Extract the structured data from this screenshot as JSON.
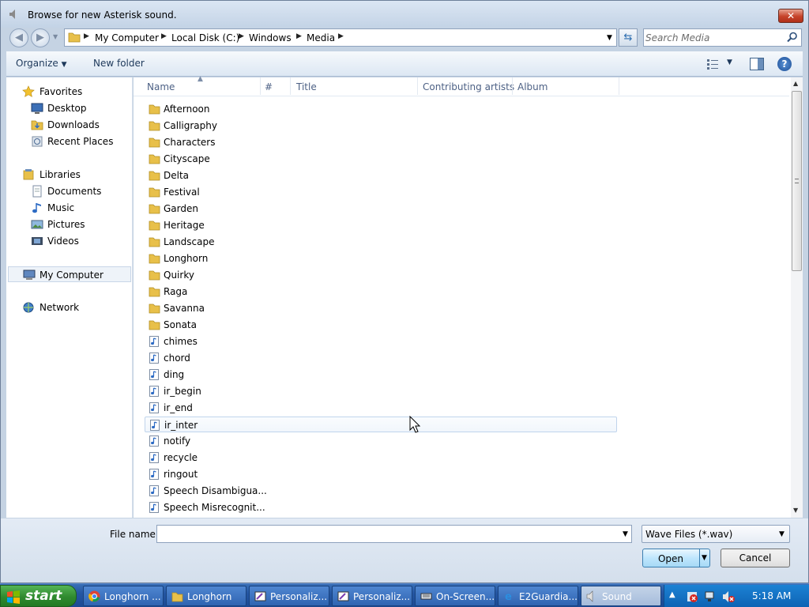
{
  "window": {
    "title": "Browse for new Asterisk sound.",
    "close_glyph": "✕"
  },
  "address": {
    "crumbs": [
      "My Computer",
      "Local Disk (C:)",
      "Windows",
      "Media"
    ],
    "search_placeholder": "Search Media"
  },
  "toolbar": {
    "organize_label": "Organize",
    "new_folder_label": "New folder"
  },
  "navpane": {
    "favorites": {
      "label": "Favorites",
      "items": [
        "Desktop",
        "Downloads",
        "Recent Places"
      ]
    },
    "libraries": {
      "label": "Libraries",
      "items": [
        "Documents",
        "Music",
        "Pictures",
        "Videos"
      ]
    },
    "computer": "My Computer",
    "network": "Network"
  },
  "columns": [
    "Name",
    "#",
    "Title",
    "Contributing artists",
    "Album"
  ],
  "files": [
    {
      "name": "Afternoon",
      "kind": "folder"
    },
    {
      "name": "Calligraphy",
      "kind": "folder"
    },
    {
      "name": "Characters",
      "kind": "folder"
    },
    {
      "name": "Cityscape",
      "kind": "folder"
    },
    {
      "name": "Delta",
      "kind": "folder"
    },
    {
      "name": "Festival",
      "kind": "folder"
    },
    {
      "name": "Garden",
      "kind": "folder"
    },
    {
      "name": "Heritage",
      "kind": "folder"
    },
    {
      "name": "Landscape",
      "kind": "folder"
    },
    {
      "name": "Longhorn",
      "kind": "folder"
    },
    {
      "name": "Quirky",
      "kind": "folder"
    },
    {
      "name": "Raga",
      "kind": "folder"
    },
    {
      "name": "Savanna",
      "kind": "folder"
    },
    {
      "name": "Sonata",
      "kind": "folder"
    },
    {
      "name": "chimes",
      "kind": "audio"
    },
    {
      "name": "chord",
      "kind": "audio"
    },
    {
      "name": "ding",
      "kind": "audio"
    },
    {
      "name": "ir_begin",
      "kind": "audio"
    },
    {
      "name": "ir_end",
      "kind": "audio"
    },
    {
      "name": "ir_inter",
      "kind": "audio",
      "hovered": true
    },
    {
      "name": "notify",
      "kind": "audio"
    },
    {
      "name": "recycle",
      "kind": "audio"
    },
    {
      "name": "ringout",
      "kind": "audio"
    },
    {
      "name": "Speech Disambigua...",
      "kind": "audio"
    },
    {
      "name": "Speech Misrecognit...",
      "kind": "audio"
    }
  ],
  "bottom": {
    "filename_label": "File name:",
    "filename_value": "",
    "filetype_value": "Wave Files (*.wav)",
    "open_label": "Open",
    "cancel_label": "Cancel"
  },
  "taskbar": {
    "start_label": "start",
    "tasks": [
      {
        "label": "Longhorn ...",
        "icon": "chrome-icon"
      },
      {
        "label": "Longhorn",
        "icon": "folder-icon"
      },
      {
        "label": "Personaliz...",
        "icon": "personalize-icon"
      },
      {
        "label": "Personaliz...",
        "icon": "personalize-icon"
      },
      {
        "label": "On-Screen...",
        "icon": "keyboard-icon"
      },
      {
        "label": "E2Guardia...",
        "icon": "ie-icon"
      },
      {
        "label": "Sound",
        "icon": "speaker-icon",
        "active": true
      }
    ],
    "clock": "5:18 AM"
  },
  "colors": {
    "window_frame": "#c5d3e3",
    "taskbar": "#2456a2",
    "start_green": "#2f8a2f",
    "folder_yellow": "#e8c04a",
    "link_text": "#1e395b"
  }
}
